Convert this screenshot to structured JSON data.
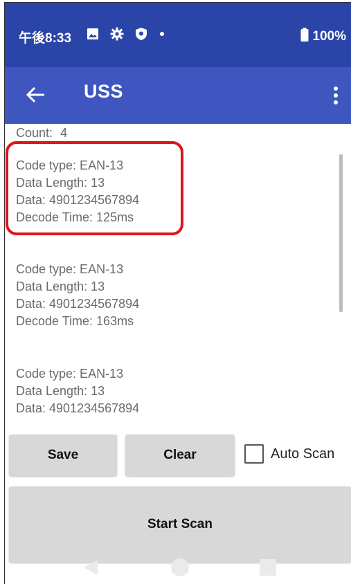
{
  "status_bar": {
    "time": "午後8:33",
    "icons": [
      "image-icon",
      "gear-icon",
      "shield-icon",
      "dot-icon"
    ],
    "battery_text": "100%"
  },
  "app_bar": {
    "title": "USS"
  },
  "results": {
    "count_label": "Count:",
    "count_value": "4",
    "records": [
      {
        "code_type": "Code type: EAN-13",
        "data_length": "Data Length: 13",
        "data": "Data: 4901234567894",
        "decode_time": "Decode Time: 125ms"
      },
      {
        "code_type": "Code type: EAN-13",
        "data_length": "Data Length: 13",
        "data": "Data: 4901234567894",
        "decode_time": "Decode Time: 163ms"
      },
      {
        "code_type": "Code type: EAN-13",
        "data_length": "Data Length: 13",
        "data": "Data: 4901234567894"
      }
    ]
  },
  "controls": {
    "save_label": "Save",
    "clear_label": "Clear",
    "auto_scan_label": "Auto Scan",
    "auto_scan_checked": false,
    "start_scan_label": "Start Scan"
  },
  "colors": {
    "status_bar_bg": "#2a44a8",
    "app_bar_bg": "#3f56c0",
    "highlight": "#e0141a",
    "button_bg": "#d8d8d8"
  }
}
